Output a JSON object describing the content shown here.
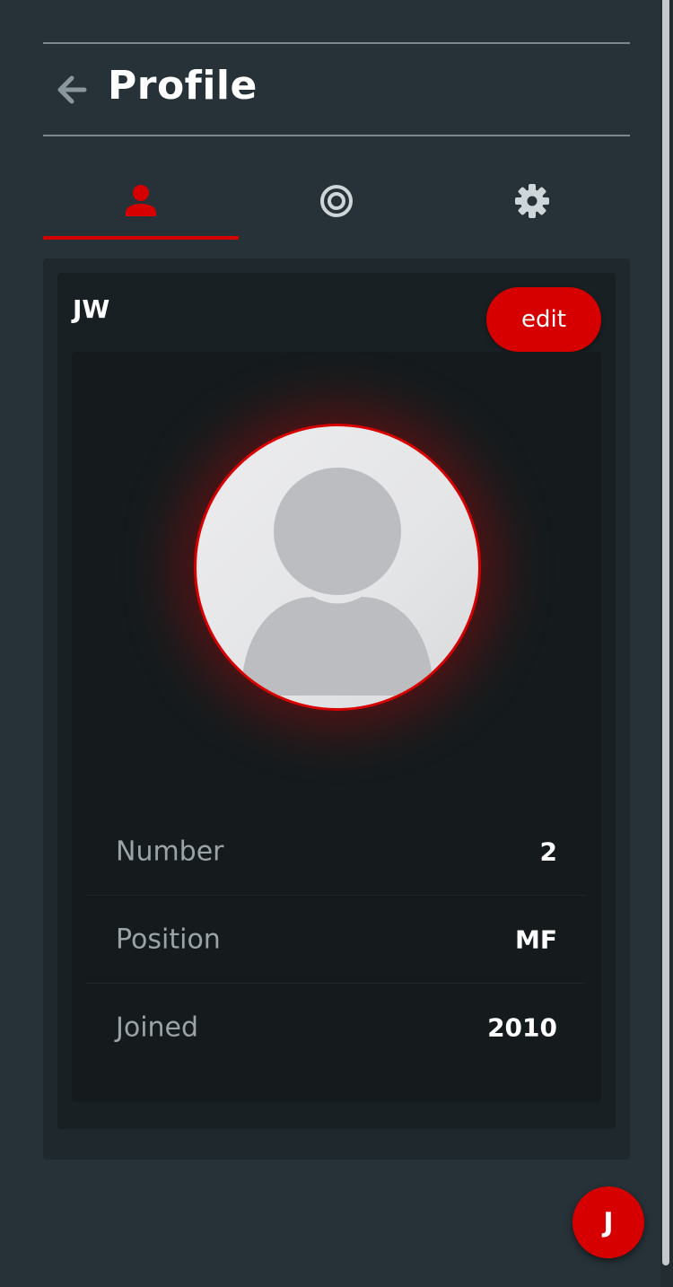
{
  "header": {
    "title": "Profile",
    "back_icon": "arrow-left-icon"
  },
  "tabs": [
    {
      "icon": "person-icon",
      "active": true
    },
    {
      "icon": "target-icon",
      "active": false
    },
    {
      "icon": "gear-icon",
      "active": false
    }
  ],
  "profile": {
    "initials": "JW",
    "edit_label": "edit",
    "avatar_icon": "default-avatar-icon",
    "stats": [
      {
        "label": "Number",
        "value": "2"
      },
      {
        "label": "Position",
        "value": "MF"
      },
      {
        "label": "Joined",
        "value": "2010"
      }
    ]
  },
  "fab": {
    "label": "J"
  },
  "colors": {
    "background": "#263238",
    "accent": "#d60000",
    "card": "#192023",
    "panel": "#151b1d",
    "inactive_icon": "#cfd6d9"
  }
}
